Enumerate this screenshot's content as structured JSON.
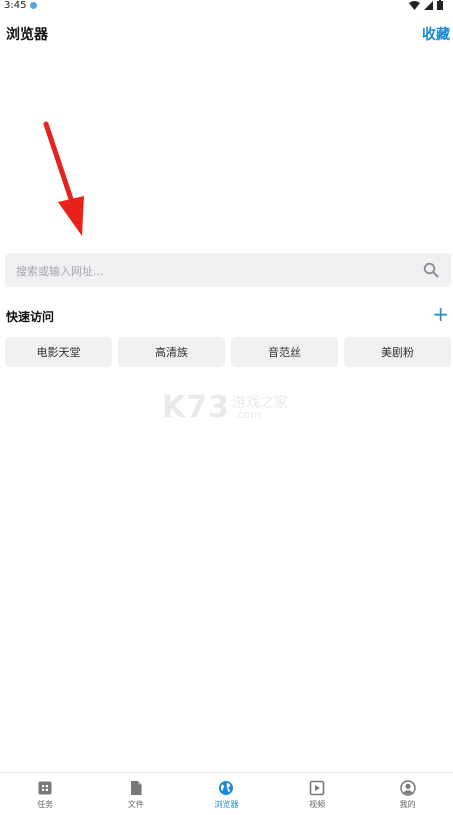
{
  "status": {
    "time": "3:45"
  },
  "header": {
    "title": "浏览器",
    "favorites": "收藏"
  },
  "search": {
    "placeholder": "搜索或输入网址..."
  },
  "quick_access": {
    "title": "快速访问",
    "add": "+",
    "items": [
      "电影天堂",
      "高清族",
      "音范丝",
      "美剧粉"
    ]
  },
  "watermark": {
    "logo": "K73",
    "site": "游戏之家",
    "domain": ".com"
  },
  "bottom_nav": {
    "items": [
      {
        "label": "任务",
        "icon": "task-icon"
      },
      {
        "label": "文件",
        "icon": "file-icon"
      },
      {
        "label": "浏览器",
        "icon": "globe-icon",
        "active": true
      },
      {
        "label": "视频",
        "icon": "video-icon"
      },
      {
        "label": "我的",
        "icon": "profile-icon"
      }
    ]
  },
  "colors": {
    "accent": "#1a8ad6",
    "arrow": "#e8211b",
    "surface": "#f0f0f3"
  }
}
